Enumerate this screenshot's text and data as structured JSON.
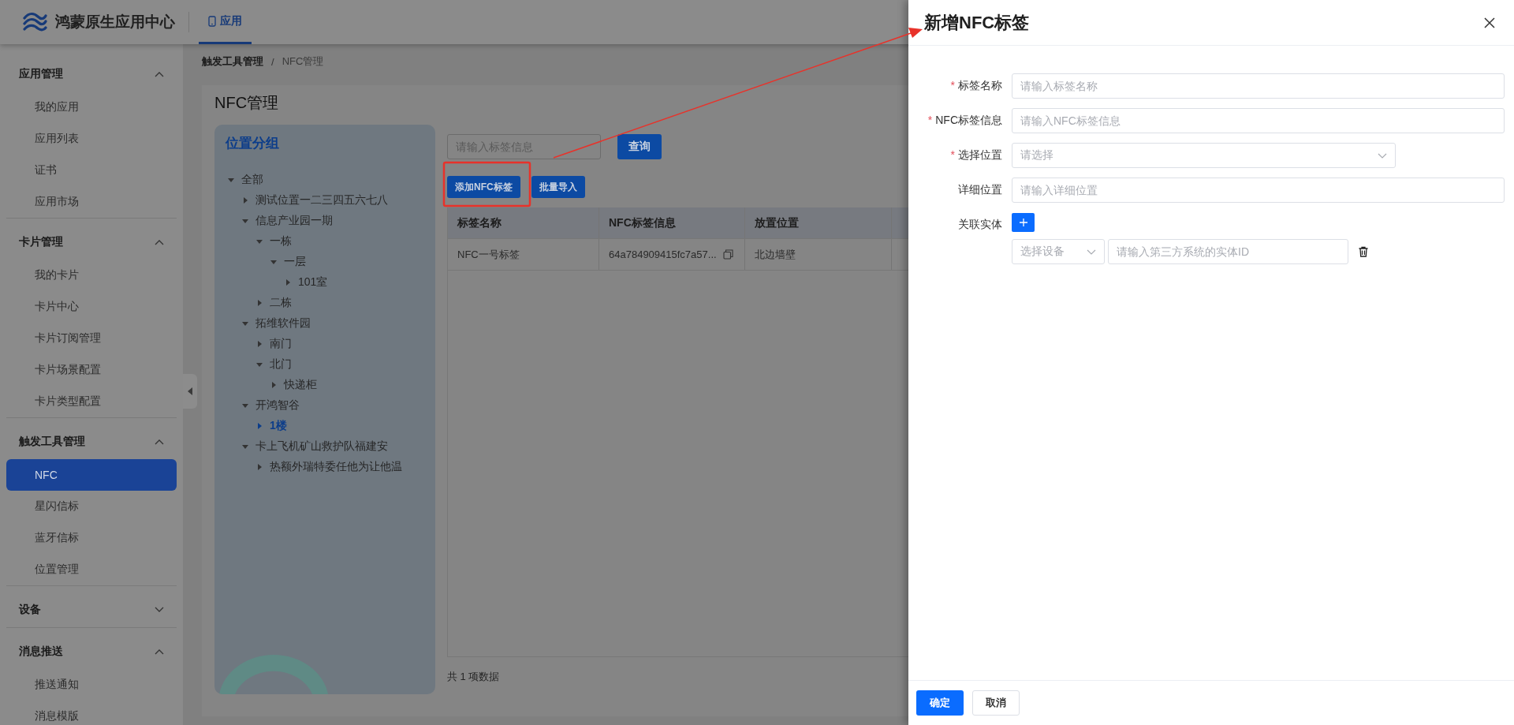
{
  "header": {
    "app_name": "鸿蒙原生应用中心",
    "tabs": [
      {
        "label": "应用",
        "selected": true
      }
    ]
  },
  "sidebar": {
    "sections": [
      {
        "title": "应用管理",
        "expanded": true,
        "items": [
          {
            "label": "我的应用",
            "selected": false
          },
          {
            "label": "应用列表",
            "selected": false
          },
          {
            "label": "证书",
            "selected": false
          },
          {
            "label": "应用市场",
            "selected": false
          }
        ]
      },
      {
        "title": "卡片管理",
        "expanded": true,
        "items": [
          {
            "label": "我的卡片",
            "selected": false
          },
          {
            "label": "卡片中心",
            "selected": false
          },
          {
            "label": "卡片订阅管理",
            "selected": false
          },
          {
            "label": "卡片场景配置",
            "selected": false
          },
          {
            "label": "卡片类型配置",
            "selected": false
          }
        ]
      },
      {
        "title": "触发工具管理",
        "expanded": true,
        "items": [
          {
            "label": "NFC",
            "selected": true
          },
          {
            "label": "星闪信标",
            "selected": false
          },
          {
            "label": "蓝牙信标",
            "selected": false
          },
          {
            "label": "位置管理",
            "selected": false
          }
        ]
      },
      {
        "title": "设备",
        "expanded": false
      },
      {
        "title": "消息推送",
        "expanded": true,
        "items": [
          {
            "label": "推送通知",
            "selected": false
          },
          {
            "label": "消息模版",
            "selected": false
          }
        ]
      }
    ]
  },
  "breadcrumb": [
    "触发工具管理",
    "NFC管理"
  ],
  "breadcrumb_separator": "/",
  "page_title": "NFC管理",
  "location_panel": {
    "title": "位置分组",
    "tree": [
      {
        "label": "全部",
        "expanded": true,
        "selected": false,
        "children": [
          {
            "label": "测试位置一二三四五六七八",
            "expanded": false,
            "selected": false
          },
          {
            "label": "信息产业园一期",
            "expanded": true,
            "selected": false,
            "children": [
              {
                "label": "一栋",
                "expanded": true,
                "selected": false,
                "children": [
                  {
                    "label": "一层",
                    "expanded": true,
                    "selected": false,
                    "children": [
                      {
                        "label": "101室",
                        "expanded": false,
                        "selected": false
                      }
                    ]
                  }
                ]
              },
              {
                "label": "二栋",
                "expanded": false,
                "selected": false
              }
            ]
          },
          {
            "label": "拓维软件园",
            "expanded": true,
            "selected": false,
            "children": [
              {
                "label": "南门",
                "expanded": false,
                "selected": false
              },
              {
                "label": "北门",
                "expanded": true,
                "selected": false,
                "children": [
                  {
                    "label": "快递柜",
                    "expanded": false,
                    "selected": false
                  }
                ]
              }
            ]
          },
          {
            "label": "开鸿智谷",
            "expanded": true,
            "selected": false,
            "children": [
              {
                "label": "1楼",
                "expanded": false,
                "selected": true
              }
            ]
          },
          {
            "label": "卡上飞机矿山救护队福建安",
            "expanded": true,
            "selected": false,
            "children": [
              {
                "label": "热额外瑞特委任他为让他温",
                "expanded": false,
                "selected": false
              }
            ]
          }
        ]
      }
    ]
  },
  "search": {
    "placeholder": "请输入标签信息"
  },
  "query_button": "查询",
  "actions": [
    "添加NFC标签",
    "批量导入"
  ],
  "table": {
    "columns": [
      "标签名称",
      "NFC标签信息",
      "放置位置"
    ],
    "rows": [
      [
        "NFC一号标签",
        "64a784909415fc7a57...",
        "北边墙壁"
      ]
    ]
  },
  "footer": "共 1 项数据",
  "drawer": {
    "title": "新增NFC标签",
    "required_mark": "*",
    "fields": [
      {
        "label": "标签名称",
        "required": true,
        "kind": "input",
        "placeholder": "请输入标签名称"
      },
      {
        "label": "NFC标签信息",
        "required": true,
        "kind": "input",
        "placeholder": "请输入NFC标签信息"
      },
      {
        "label": "选择位置",
        "required": true,
        "kind": "select",
        "placeholder": "请选择"
      },
      {
        "label": "详细位置",
        "required": false,
        "kind": "input",
        "placeholder": "请输入详细位置"
      },
      {
        "label": "关联实体",
        "required": false,
        "kind": "add"
      }
    ],
    "entity_row": {
      "device_placeholder": "选择设备",
      "id_placeholder": "请输入第三方系统的实体ID"
    },
    "buttons": [
      {
        "label": "确定",
        "kind": "primary"
      },
      {
        "label": "取消",
        "kind": "default"
      }
    ]
  }
}
